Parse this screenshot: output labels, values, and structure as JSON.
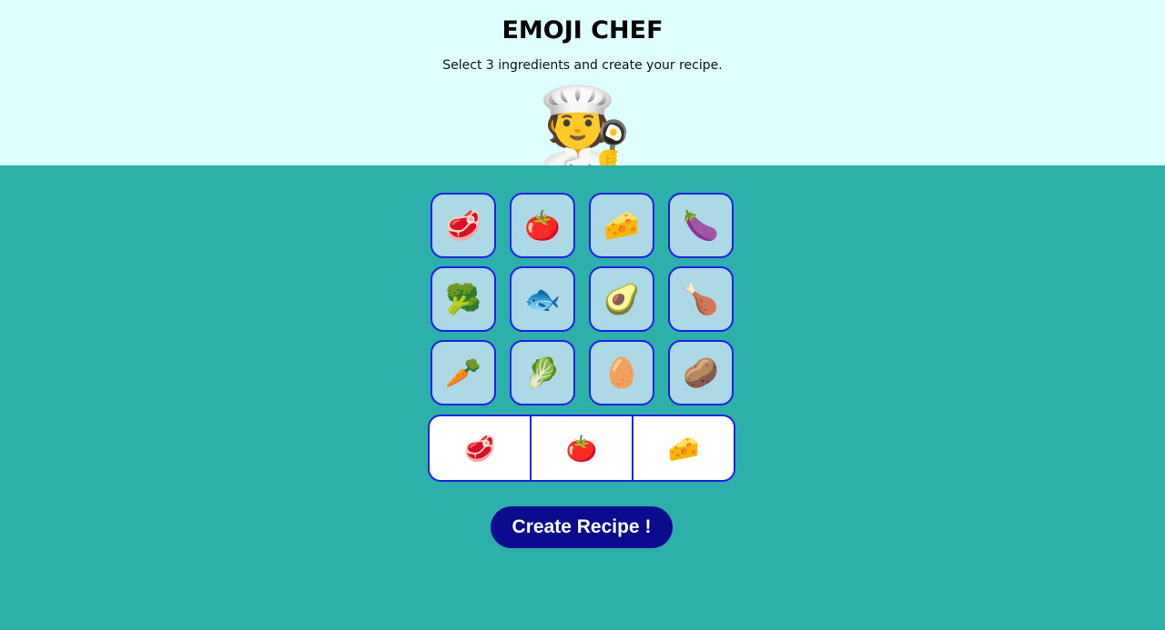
{
  "header": {
    "title": "EMOJI CHEF",
    "subtitle": "Select 3 ingredients and create your recipe.",
    "chef_emoji": "🧑‍🍳"
  },
  "ingredients": [
    {
      "name": "steak-icon",
      "emoji": "🥩"
    },
    {
      "name": "tomato-icon",
      "emoji": "🍅"
    },
    {
      "name": "cheese-icon",
      "emoji": "🧀"
    },
    {
      "name": "eggplant-icon",
      "emoji": "🍆"
    },
    {
      "name": "broccoli-icon",
      "emoji": "🥦"
    },
    {
      "name": "fish-icon",
      "emoji": "🐟"
    },
    {
      "name": "avocado-icon",
      "emoji": "🥑"
    },
    {
      "name": "poultry-leg-icon",
      "emoji": "🍗"
    },
    {
      "name": "carrot-icon",
      "emoji": "🥕"
    },
    {
      "name": "leafy-green-icon",
      "emoji": "🥬"
    },
    {
      "name": "egg-icon",
      "emoji": "🥚"
    },
    {
      "name": "potato-icon",
      "emoji": "🥔"
    }
  ],
  "selected": [
    {
      "name": "steak-icon",
      "emoji": "🥩"
    },
    {
      "name": "tomato-icon",
      "emoji": "🍅"
    },
    {
      "name": "cheese-icon",
      "emoji": "🧀"
    }
  ],
  "create_button": {
    "label": "Create Recipe !"
  },
  "colors": {
    "header_bg": "#dffefe",
    "body_bg": "#2bb0aa",
    "tile_bg": "#add8e6",
    "tile_border": "#1d1ef0",
    "button_bg": "#0a0b8f"
  }
}
